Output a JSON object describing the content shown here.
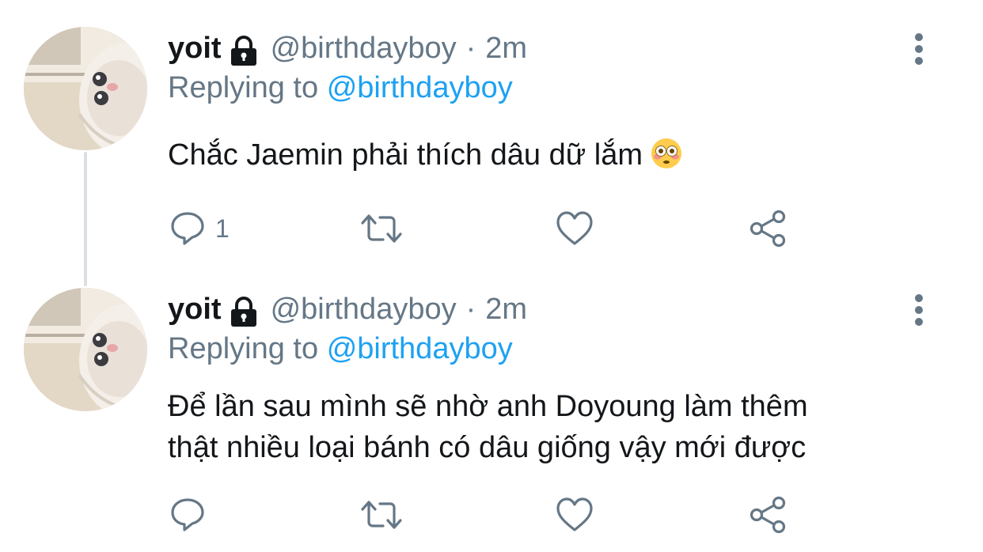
{
  "tweets": [
    {
      "display_name": "yoit",
      "handle": "@birthdayboy",
      "separator": "·",
      "time": "2m",
      "replying_prefix": "Replying to",
      "replying_to": "@birthdayboy",
      "text": "Chắc Jaemin phải thích dâu dữ lắm",
      "emoji": "flushed-face-emoji",
      "reply_count": "1",
      "icons": [
        "lock-icon",
        "more-icon",
        "reply-icon",
        "retweet-icon",
        "like-icon",
        "share-icon"
      ]
    },
    {
      "display_name": "yoit",
      "handle": "@birthdayboy",
      "separator": "·",
      "time": "2m",
      "replying_prefix": "Replying to",
      "replying_to": "@birthdayboy",
      "text_line1": "Để lần sau mình sẽ nhờ anh Doyoung làm thêm",
      "text_line2": "thật nhiều loại bánh có dâu giống vậy mới được",
      "icons": [
        "lock-icon",
        "more-icon",
        "reply-icon",
        "retweet-icon",
        "like-icon",
        "share-icon"
      ]
    }
  ],
  "colors": {
    "text": "#14171a",
    "secondary": "#657786",
    "accent": "#1da1f2",
    "thread_line": "#d9dfe4"
  }
}
